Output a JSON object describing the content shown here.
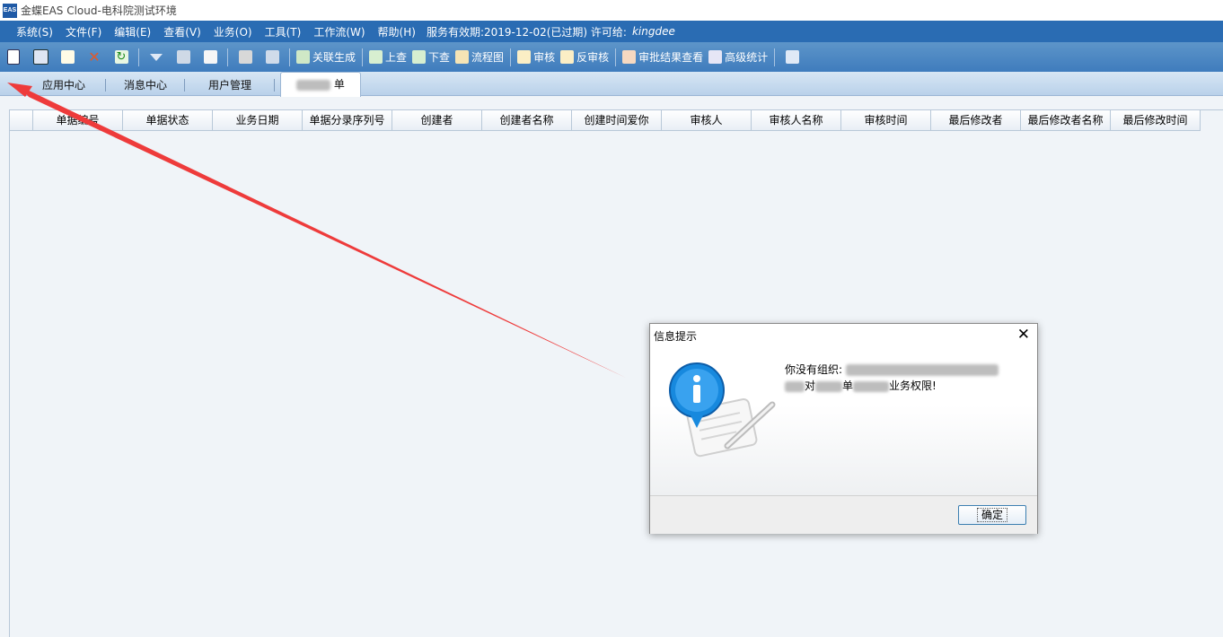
{
  "window": {
    "icon_text": "EAS",
    "title": "金蝶EAS Cloud-电科院测试环境"
  },
  "menubar": {
    "items": [
      "系统(S)",
      "文件(F)",
      "编辑(E)",
      "查看(V)",
      "业务(O)",
      "工具(T)",
      "工作流(W)",
      "帮助(H)"
    ],
    "service_info": "服务有效期:2019-12-02(已过期) 许可给:",
    "license_name": "kingdee"
  },
  "toolbar": {
    "link_generate": "关联生成",
    "trace_up": "上查",
    "trace_down": "下查",
    "flow_chart": "流程图",
    "audit": "审核",
    "unaudit": "反审核",
    "approval_result": "审批结果查看",
    "advanced_stats": "高级统计"
  },
  "tabs": {
    "app_center": "应用中心",
    "message_center": "消息中心",
    "user_management": "用户管理",
    "current_suffix": "单"
  },
  "table": {
    "columns": [
      "单据编号",
      "单据状态",
      "业务日期",
      "单据分录序列号",
      "创建者",
      "创建者名称",
      "创建时间爱你",
      "审核人",
      "审核人名称",
      "审核时间",
      "最后修改者",
      "最后修改者名称",
      "最后修改时间"
    ]
  },
  "dialog": {
    "title": "信息提示",
    "close_glyph": "✕",
    "message_line1": "你没有组织:",
    "message_line2_part1": "对",
    "message_line2_part2": "单",
    "message_line2_part3": "业务权限!",
    "ok_label": "确定"
  },
  "colors": {
    "menubar": "#2a6cb3",
    "toolbar": "#4a86c4",
    "annotation_arrow": "#ee3b3b"
  }
}
